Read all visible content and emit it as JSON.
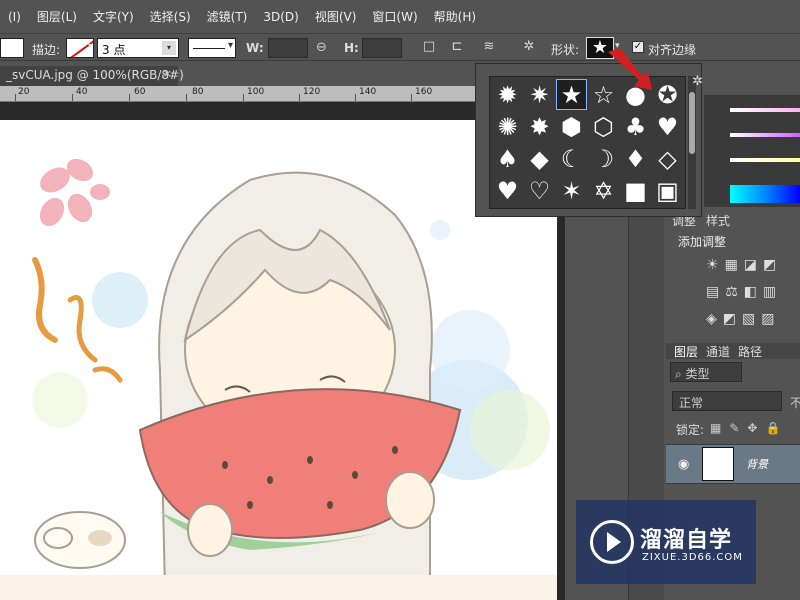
{
  "menu": [
    "(I)",
    "图层(L)",
    "文字(Y)",
    "选择(S)",
    "滤镜(T)",
    "3D(D)",
    "视图(V)",
    "窗口(W)",
    "帮助(H)"
  ],
  "options": {
    "stroke_label": "描边:",
    "stroke_width": "3 点",
    "w_label": "W:",
    "h_label": "H:",
    "shape_label": "形状:",
    "align_edges_label": "对齐边缘",
    "align_edges_checked": "✓"
  },
  "document_tab": {
    "title": "_svCUA.jpg @ 100%(RGB/8#)",
    "close": "×"
  },
  "ruler": [
    "20",
    "40",
    "60",
    "80",
    "100",
    "120",
    "140",
    "160"
  ],
  "shape_picker": {
    "shapes": [
      "✹",
      "✷",
      "★",
      "☆",
      "●",
      "✪",
      "✺",
      "✸",
      "⬢",
      "⬡",
      "♣",
      "♥",
      "♠",
      "◆",
      "☾",
      "☽",
      "♦",
      "◇",
      "♥",
      "♡",
      "✶",
      "✡",
      "■",
      "▣"
    ],
    "selected_index": 2
  },
  "adjustments": {
    "tab_adjust": "调整",
    "tab_style": "样式",
    "title": "添加调整",
    "row1": [
      "☀",
      "▦",
      "◪",
      "◩"
    ],
    "row2": [
      "▤",
      "⚖",
      "◧",
      "▥"
    ],
    "row3": [
      "◈",
      "◩",
      "▧",
      "▨"
    ]
  },
  "layers": {
    "tabs": [
      "图层",
      "通道",
      "路径"
    ],
    "type_filter": "⌕ 类型",
    "blend_mode": "正常",
    "opacity_prefix": "不",
    "lock_label": "锁定:",
    "lock_icons": [
      "▦",
      "✎",
      "✥",
      "🔒"
    ],
    "layer_name": "背景"
  },
  "watermark": {
    "title": "溜溜自学",
    "url": "ZIXUE.3D66.COM"
  },
  "colors": {
    "ui_bg": "#535353",
    "canvas_bg": "#ffffff",
    "selection": "#8ab4ff",
    "red_arrow": "#d02020"
  }
}
